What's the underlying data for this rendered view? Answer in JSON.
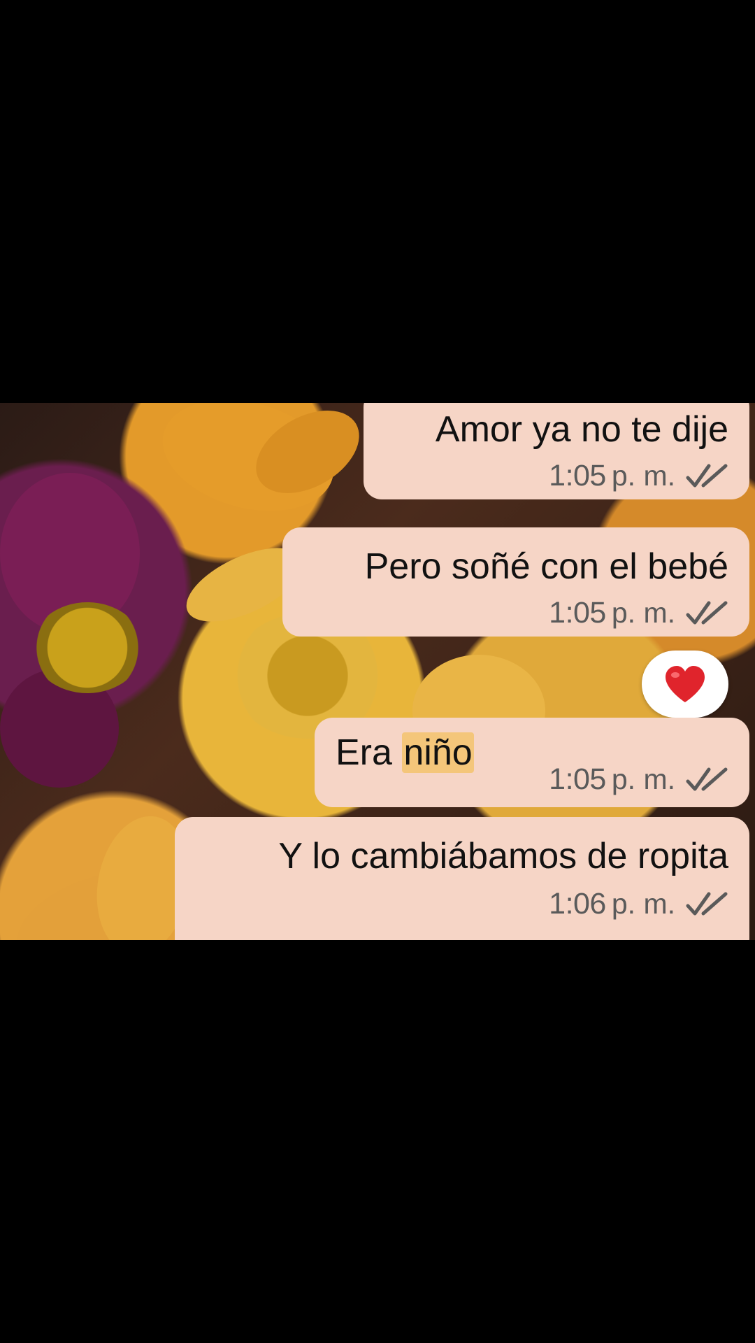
{
  "messages": [
    {
      "text": "Amor ya no te dije",
      "time": "1:05",
      "ampm": "p. m."
    },
    {
      "text": "Pero soñé con el bebé",
      "time": "1:05",
      "ampm": "p. m."
    },
    {
      "text_before": "Era ",
      "text_highlight": "niño",
      "time": "1:05",
      "ampm": "p. m.",
      "reaction": "red-heart"
    },
    {
      "text": "Y lo cambiábamos de ropita",
      "time": "1:06",
      "ampm": "p. m."
    }
  ],
  "colors": {
    "bubble": "#f6d5c6",
    "highlight": "#f4c67a",
    "meta_text": "#5a5a5a",
    "heart": "#e0242c"
  },
  "icons": {
    "read_receipt": "double-check-icon",
    "reaction": "heart-icon"
  }
}
